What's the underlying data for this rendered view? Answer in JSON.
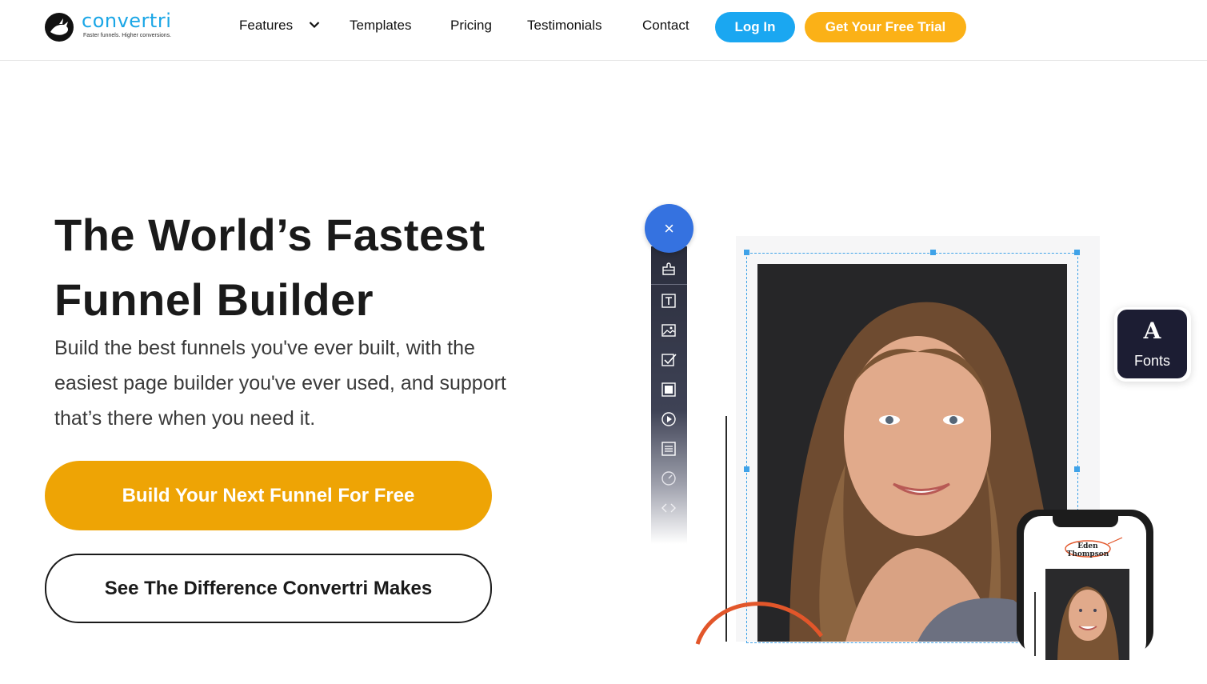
{
  "brand": {
    "name": "convertri",
    "tagline": "Faster funnels. Higher conversions.",
    "colors": {
      "primary_blue": "#1aa7f1",
      "accent_orange": "#fbb117",
      "cta_gold": "#eea405"
    }
  },
  "nav": {
    "features": "Features",
    "templates": "Templates",
    "pricing": "Pricing",
    "testimonials": "Testimonials",
    "contact": "Contact",
    "login": "Log In",
    "trial": "Get Your Free Trial"
  },
  "hero": {
    "title": "The World’s Fastest Funnel Builder",
    "subtitle": "Build the best funnels you've ever built, with the easiest page builder you've ever used, and support that’s there when you need it.",
    "cta_primary": "Build Your Next Funnel For Free",
    "cta_secondary": "See The Difference Convertri Makes"
  },
  "editor": {
    "close_symbol": "×",
    "toolbar_icons": [
      "puzzle-icon",
      "text-icon",
      "image-icon",
      "checkbox-icon",
      "box-icon",
      "video-icon",
      "list-icon",
      "timer-icon",
      "code-icon"
    ],
    "fonts_glyph": "A",
    "fonts_label": "Fonts",
    "phone_name": "Eden Thompson"
  }
}
